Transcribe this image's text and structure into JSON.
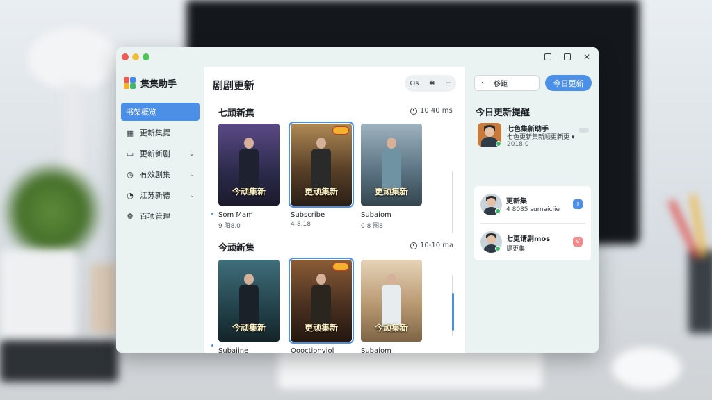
{
  "app": {
    "brand": "集集助手",
    "colors": {
      "accent": "#4c8fe6",
      "sidebar": "#eaf3f1",
      "panel": "#ffffff"
    }
  },
  "window_controls": {
    "minimize_icon": "minimize-icon",
    "maximize_icon": "maximize-icon",
    "close": "✕"
  },
  "sidebar": {
    "items": [
      {
        "label": "书架概览",
        "icon": "bookshelf-icon",
        "glyph": "▤",
        "active": true,
        "chevron": false
      },
      {
        "label": "更新集提",
        "icon": "calendar-icon",
        "glyph": "▦",
        "active": false,
        "chevron": false
      },
      {
        "label": "更新新剧",
        "icon": "screen-icon",
        "glyph": "▭",
        "active": false,
        "chevron": true
      },
      {
        "label": "有效剧集",
        "icon": "dial-icon",
        "glyph": "◷",
        "active": false,
        "chevron": true
      },
      {
        "label": "江苏新德",
        "icon": "clock-icon",
        "glyph": "◔",
        "active": false,
        "chevron": true
      },
      {
        "label": "百项管理",
        "icon": "gear-icon",
        "glyph": "⚙",
        "active": false,
        "chevron": false
      }
    ]
  },
  "main": {
    "title": "剧剧更新",
    "tools": [
      "Os",
      "✱",
      "±"
    ],
    "sections": [
      {
        "title": "七顽新集",
        "meta": "10 40 ms",
        "cards": [
          {
            "title": "Som Mam",
            "sub": "9 阳8.0",
            "poster_text": "今顽集新",
            "selected": false
          },
          {
            "title": "Subscribe",
            "sub": "4-8.18",
            "poster_text": "更顽集新",
            "selected": true
          },
          {
            "title": "Subaiom",
            "sub": "0 8 图8",
            "poster_text": "更顽集新",
            "selected": false
          }
        ]
      },
      {
        "title": "今顽新集",
        "meta": "10-10 ma",
        "cards": [
          {
            "title": "Subaiine",
            "sub": "",
            "poster_text": "今顽集新",
            "selected": false
          },
          {
            "title": "Oooctionviol",
            "sub": "",
            "poster_text": "更顽集新",
            "selected": true
          },
          {
            "title": "Subaiom",
            "sub": "",
            "poster_text": "今顽集新",
            "selected": false
          }
        ]
      }
    ]
  },
  "right": {
    "back_label": "移距",
    "today_button": "今日更新",
    "title": "今日更新提醒",
    "top_notification": {
      "title": "七色集新助手",
      "desc": "七色更新集新顺更新更 ▾",
      "time": "2018:0"
    },
    "list": [
      {
        "title": "更新集",
        "sub": "4 8085 sumaiciie",
        "icon_glyph": "i",
        "icon_color": "#4c8fe6"
      },
      {
        "title": "七更请剧mos",
        "sub": "提更集",
        "icon_glyph": "V",
        "icon_color": "#f28a8a"
      }
    ]
  }
}
